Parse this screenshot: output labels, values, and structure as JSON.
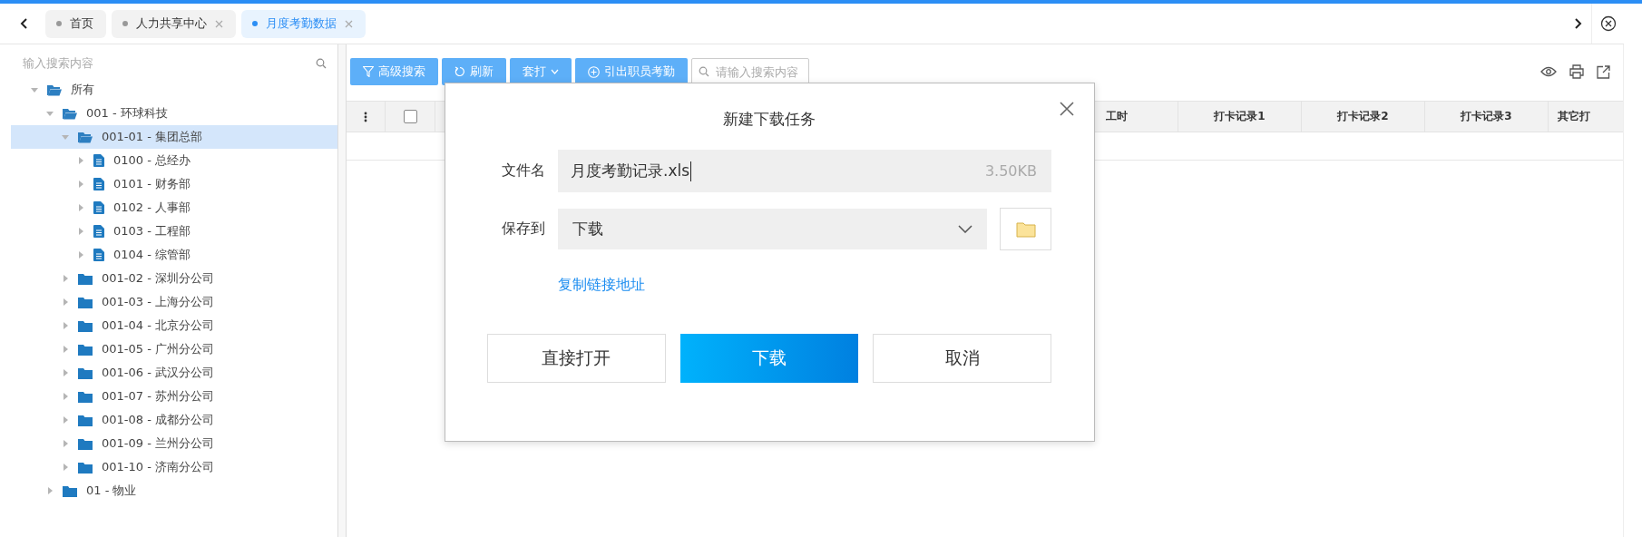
{
  "tabs": [
    {
      "label": "首页",
      "selected": false,
      "closable": false
    },
    {
      "label": "人力共享中心",
      "selected": false,
      "closable": true
    },
    {
      "label": "月度考勤数据",
      "selected": true,
      "closable": true
    }
  ],
  "sidebar": {
    "search": {
      "placeholder": "输入搜索内容"
    },
    "tree": [
      {
        "label": "所有",
        "kind": "folder",
        "expanded": true,
        "selected": false,
        "children": [
          {
            "label": "001 - 环球科技",
            "kind": "folder",
            "expanded": true,
            "selected": false,
            "children": [
              {
                "label": "001-01 - 集团总部",
                "kind": "folder",
                "expanded": true,
                "selected": true,
                "children": [
                  {
                    "label": "0100 - 总经办",
                    "kind": "doc",
                    "expanded": false,
                    "selected": false
                  },
                  {
                    "label": "0101 - 财务部",
                    "kind": "doc",
                    "expanded": false,
                    "selected": false
                  },
                  {
                    "label": "0102 - 人事部",
                    "kind": "doc",
                    "expanded": false,
                    "selected": false
                  },
                  {
                    "label": "0103 - 工程部",
                    "kind": "doc",
                    "expanded": false,
                    "selected": false
                  },
                  {
                    "label": "0104 - 综管部",
                    "kind": "doc",
                    "expanded": false,
                    "selected": false
                  }
                ]
              },
              {
                "label": "001-02 - 深圳分公司",
                "kind": "folder",
                "expanded": false,
                "selected": false
              },
              {
                "label": "001-03 - 上海分公司",
                "kind": "folder",
                "expanded": false,
                "selected": false
              },
              {
                "label": "001-04 - 北京分公司",
                "kind": "folder",
                "expanded": false,
                "selected": false
              },
              {
                "label": "001-05 - 广州分公司",
                "kind": "folder",
                "expanded": false,
                "selected": false
              },
              {
                "label": "001-06 - 武汉分公司",
                "kind": "folder",
                "expanded": false,
                "selected": false
              },
              {
                "label": "001-07 - 苏州分公司",
                "kind": "folder",
                "expanded": false,
                "selected": false
              },
              {
                "label": "001-08 - 成都分公司",
                "kind": "folder",
                "expanded": false,
                "selected": false
              },
              {
                "label": "001-09 - 兰州分公司",
                "kind": "folder",
                "expanded": false,
                "selected": false
              },
              {
                "label": "001-10 - 济南分公司",
                "kind": "folder",
                "expanded": false,
                "selected": false
              }
            ]
          },
          {
            "label": "01 - 物业",
            "kind": "folder",
            "expanded": false,
            "selected": false
          }
        ]
      }
    ]
  },
  "toolbar": {
    "buttons": [
      {
        "label": "高级搜索",
        "kind": "filter"
      },
      {
        "label": "刷新",
        "kind": "refresh"
      },
      {
        "label": "套打",
        "kind": "dropdown"
      },
      {
        "label": "引出职员考勤",
        "kind": "add"
      }
    ],
    "search": {
      "placeholder": "请输入搜索内容"
    }
  },
  "table": {
    "select_all": {
      "checked": false
    },
    "columns": [
      "工时",
      "打卡记录1",
      "打卡记录2",
      "打卡记录3",
      "其它打"
    ]
  },
  "dialog": {
    "title": "新建下载任务",
    "file_name": {
      "label": "文件名",
      "value": "月度考勤记录.xls",
      "size": "3.50KB"
    },
    "save_to": {
      "label": "保存到",
      "value": "下载"
    },
    "link": "复制链接地址",
    "buttons": [
      {
        "label": "直接打开",
        "primary": false
      },
      {
        "label": "下载",
        "primary": true
      },
      {
        "label": "取消",
        "primary": false
      }
    ]
  }
}
